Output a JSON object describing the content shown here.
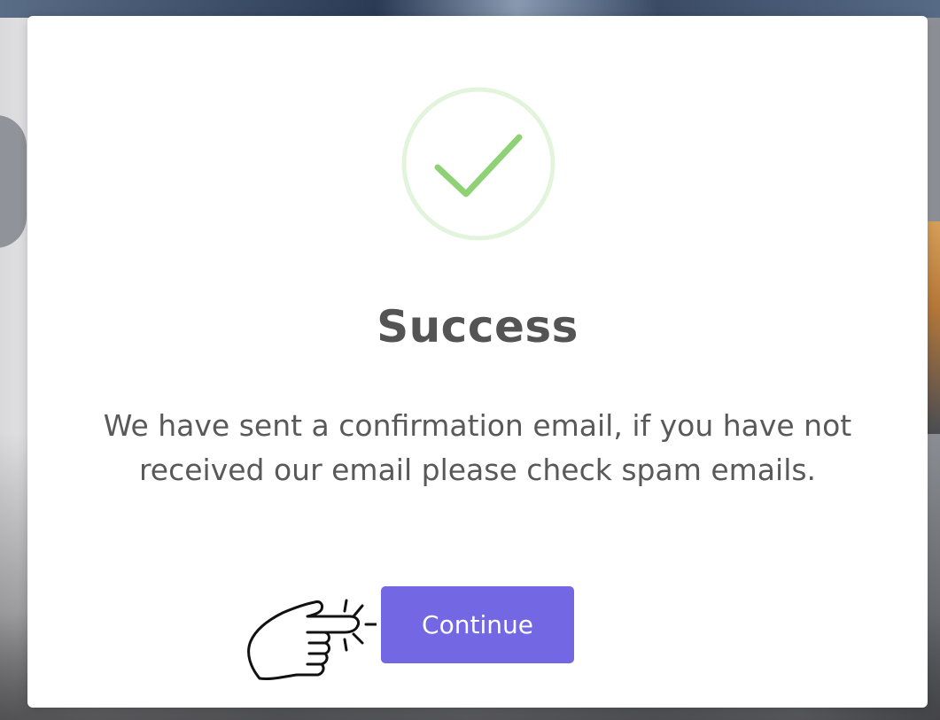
{
  "dialog": {
    "title": "Success",
    "message": "We have sent a confirmation email, if you have not received our email please check spam emails.",
    "continue_label": "Continue",
    "icons": {
      "status": "check-circle-icon",
      "pointer": "pointing-hand-icon"
    }
  },
  "colors": {
    "accent": "#7367e4",
    "success": "#8fd175",
    "success_ring": "#e3f4dc",
    "title_text": "#545454",
    "body_text": "#595959"
  }
}
